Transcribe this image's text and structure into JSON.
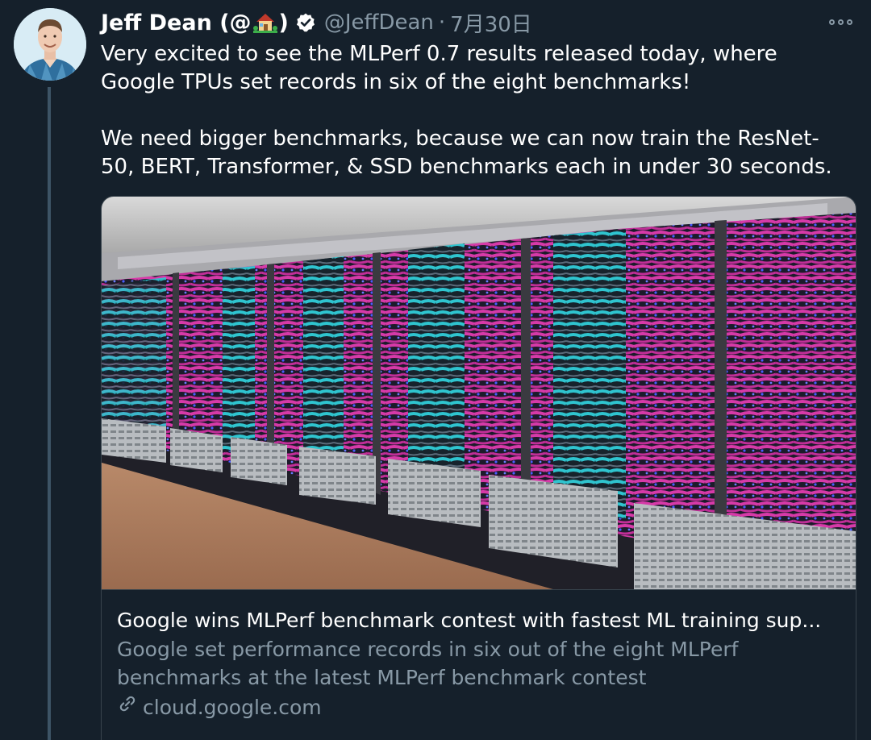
{
  "author": {
    "display_name_prefix": "Jeff Dean (@",
    "display_name_suffix": ")",
    "emoji_icon": "house-with-garden-icon",
    "handle": "@JeffDean",
    "separator": "·",
    "timestamp": "7月30日",
    "verified_icon": "verified-badge-icon",
    "avatar_icon": "avatar-photo"
  },
  "tweet": {
    "paragraphs": [
      "Very excited to see the MLPerf 0.7 results released today, where Google TPUs set records in six of the eight benchmarks!",
      "We need bigger benchmarks, because we can now train the ResNet-50, BERT, Transformer, & SSD benchmarks each in under 30 seconds."
    ],
    "more_icon": "more-options-icon"
  },
  "card": {
    "image_icon": "tpu-server-racks-photo",
    "title": "Google wins MLPerf benchmark contest with fastest ML training sup...",
    "description": "Google set performance records in six out of the eight MLPerf benchmarks at the latest MLPerf benchmark contest",
    "link_icon": "link-icon",
    "domain": "cloud.google.com"
  },
  "colors": {
    "background": "#15202b",
    "text_primary": "#ffffff",
    "text_secondary": "#8899a6",
    "border": "#38444d",
    "cable_pink": "#d63aa8",
    "cable_cyan": "#2fc4cf"
  }
}
